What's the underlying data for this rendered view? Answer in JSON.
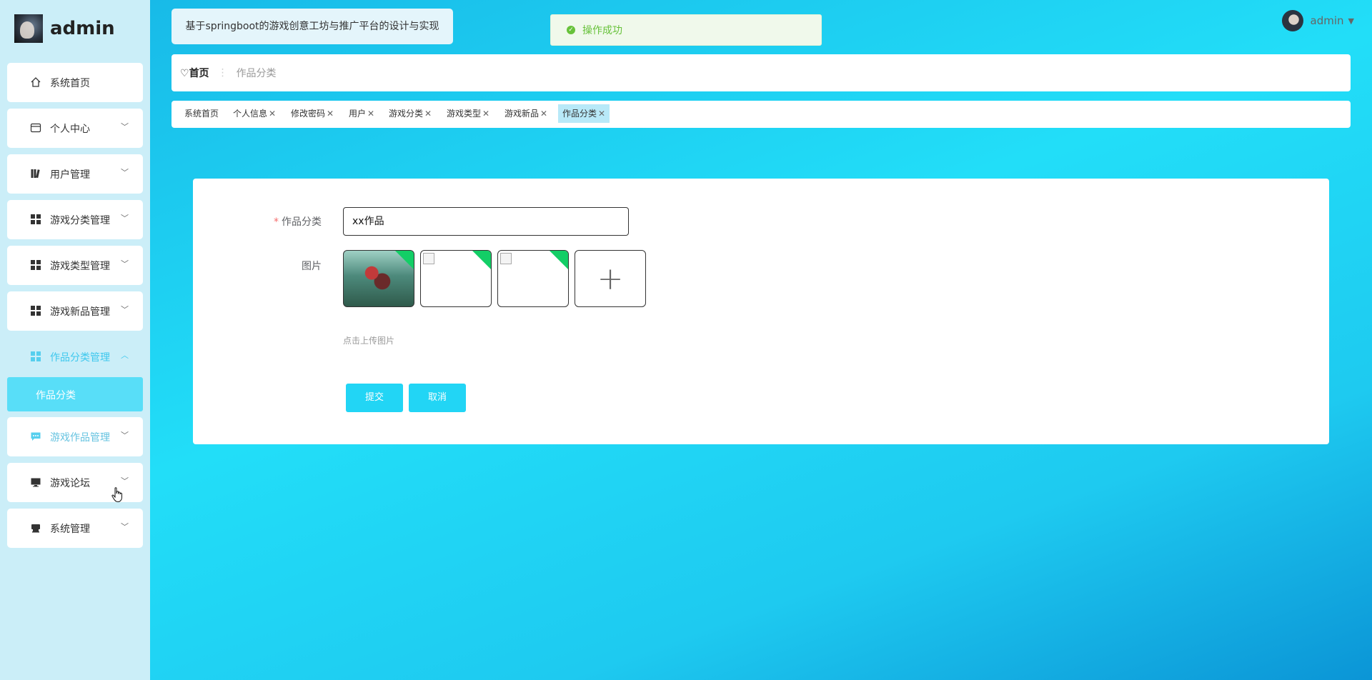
{
  "app": {
    "username": "admin",
    "title": "基于springboot的游戏创意工坊与推广平台的设计与实现"
  },
  "toast": {
    "message": "操作成功"
  },
  "user_menu": {
    "name": "admin"
  },
  "sidebar": {
    "items": [
      {
        "label": "系统首页",
        "icon": "home-icon"
      },
      {
        "label": "个人中心",
        "icon": "card-icon"
      },
      {
        "label": "用户管理",
        "icon": "books-icon"
      },
      {
        "label": "游戏分类管理",
        "icon": "grid-icon"
      },
      {
        "label": "游戏类型管理",
        "icon": "grid-icon"
      },
      {
        "label": "游戏新品管理",
        "icon": "grid-icon"
      },
      {
        "label": "作品分类管理",
        "icon": "grid-icon"
      },
      {
        "label": "游戏作品管理",
        "icon": "chat-icon"
      },
      {
        "label": "游戏论坛",
        "icon": "monitor-icon"
      },
      {
        "label": "系统管理",
        "icon": "printer-icon"
      }
    ],
    "sub_item": "作品分类"
  },
  "breadcrumb": {
    "home": "首页",
    "current": "作品分类"
  },
  "tabs": [
    {
      "label": "系统首页"
    },
    {
      "label": "个人信息"
    },
    {
      "label": "修改密码"
    },
    {
      "label": "用户"
    },
    {
      "label": "游戏分类"
    },
    {
      "label": "游戏类型"
    },
    {
      "label": "游戏新品"
    },
    {
      "label": "作品分类"
    }
  ],
  "form": {
    "category_label": "作品分类",
    "category_value": "xx作品",
    "image_label": "图片",
    "upload_hint": "点击上传图片",
    "submit": "提交",
    "cancel": "取消"
  },
  "colors": {
    "accent": "#22d5f5",
    "success": "#67c23a",
    "sidebar_bg": "#cbeef8"
  }
}
